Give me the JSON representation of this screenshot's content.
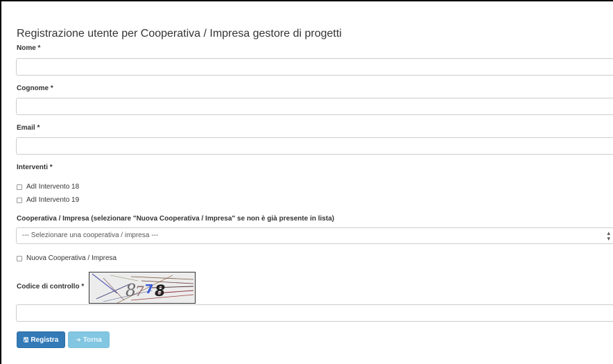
{
  "form": {
    "title": "Registrazione utente per Cooperativa / Impresa gestore di progetti",
    "nome": {
      "label": "Nome *",
      "value": "",
      "placeholder": ""
    },
    "cognome": {
      "label": "Cognome *",
      "value": "",
      "placeholder": ""
    },
    "email": {
      "label": "Email *",
      "value": "",
      "placeholder": ""
    },
    "interventi": {
      "label": "Interventi *",
      "options": [
        {
          "label": "AdI Intervento 18",
          "checked": false
        },
        {
          "label": "AdI Intervento 19",
          "checked": false
        }
      ]
    },
    "cooperativa": {
      "label": "Cooperativa / Impresa (selezionare \"Nuova Cooperativa / Impresa\" se non è già presente in lista)",
      "selected": "--- Selezionare una cooperativa / impresa ---"
    },
    "nuova_cooperativa": {
      "label": "Nuova Cooperativa / Impresa",
      "checked": false
    },
    "captcha": {
      "label": "Codice di controllo *",
      "image_text": "8778",
      "value": ""
    },
    "buttons": {
      "registra": {
        "label": "Registra",
        "icon": "floppy-disk-icon",
        "color": "#337ab7"
      },
      "torna": {
        "label": "Torna",
        "icon": "sign-in-icon",
        "color": "#82c6e2"
      }
    }
  }
}
